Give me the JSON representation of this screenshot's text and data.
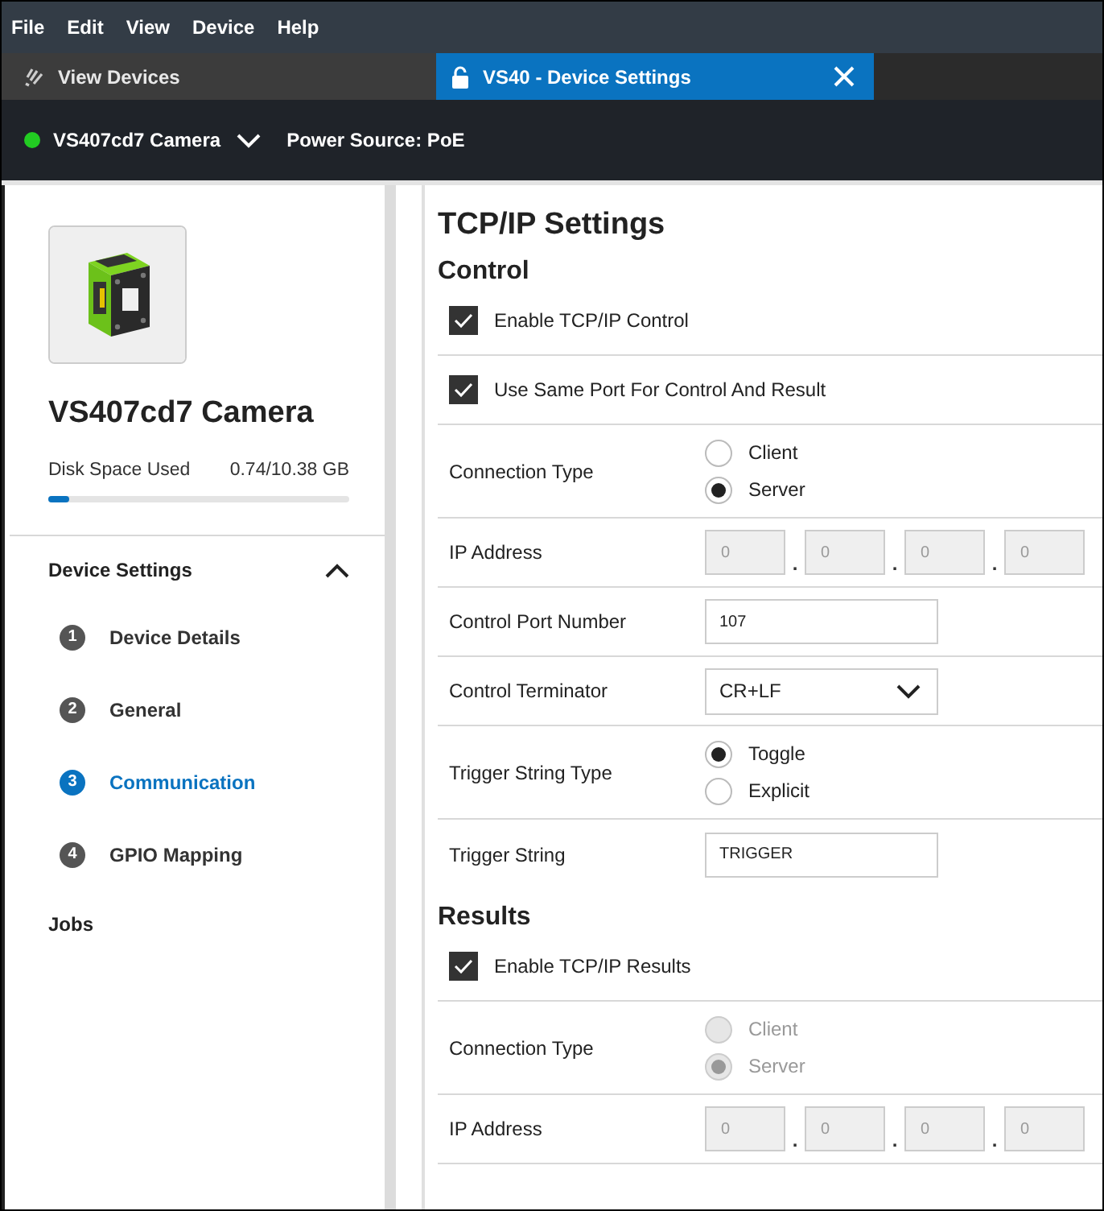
{
  "menu": [
    "File",
    "Edit",
    "View",
    "Device",
    "Help"
  ],
  "tabs": [
    {
      "kind": "browse",
      "label": "View Devices",
      "selected": false,
      "closable": false
    },
    {
      "kind": "lock",
      "label": "VS40 - Device Settings",
      "selected": true,
      "closable": true
    }
  ],
  "device_bar": {
    "online": true,
    "name": "VS407cd7 Camera",
    "power": "Power Source: PoE"
  },
  "sidebar": {
    "device_name": "VS407cd7 Camera",
    "disk": {
      "label": "Disk Space Used",
      "value": "0.74/10.38 GB",
      "level": 0.07
    },
    "section": {
      "title": "Device Settings",
      "expanded": true,
      "items": [
        {
          "number": "1",
          "label": "Device Details",
          "selected": false
        },
        {
          "number": "2",
          "label": "General",
          "selected": false
        },
        {
          "number": "3",
          "label": "Communication",
          "selected": true
        },
        {
          "number": "4",
          "label": "GPIO Mapping",
          "selected": false
        }
      ]
    },
    "jobs": "Jobs"
  },
  "content": {
    "title": "TCP/IP Settings",
    "sections": [
      {
        "heading": "Control",
        "rows": [
          {
            "kind": "checkbox",
            "label": "Enable TCP/IP Control",
            "checked": true
          },
          {
            "kind": "checkbox",
            "label": "Use Same Port For Control And Result",
            "checked": true
          },
          {
            "kind": "radio",
            "label": "Connection Type",
            "disabled": false,
            "options": [
              {
                "label": "Client",
                "selected": false
              },
              {
                "label": "Server",
                "selected": true
              }
            ]
          },
          {
            "kind": "ip",
            "label": "IP Address",
            "disabled": true,
            "separator": ".",
            "octets": [
              "0",
              "0",
              "0",
              "0"
            ]
          },
          {
            "kind": "text",
            "label": "Control Port Number",
            "value": "107"
          },
          {
            "kind": "select",
            "label": "Control Terminator",
            "value": "CR+LF"
          },
          {
            "kind": "radio",
            "label": "Trigger String Type",
            "disabled": false,
            "options": [
              {
                "label": "Toggle",
                "selected": true
              },
              {
                "label": "Explicit",
                "selected": false
              }
            ]
          },
          {
            "kind": "text",
            "label": "Trigger String",
            "value": "TRIGGER"
          }
        ]
      },
      {
        "heading": "Results",
        "rows": [
          {
            "kind": "checkbox",
            "label": "Enable TCP/IP Results",
            "checked": true
          },
          {
            "kind": "radio",
            "label": "Connection Type",
            "disabled": true,
            "options": [
              {
                "label": "Client",
                "selected": false
              },
              {
                "label": "Server",
                "selected": true
              }
            ]
          },
          {
            "kind": "ip",
            "label": "IP Address",
            "disabled": true,
            "separator": ".",
            "octets": [
              "0",
              "0",
              "0",
              "0"
            ]
          }
        ]
      }
    ]
  }
}
